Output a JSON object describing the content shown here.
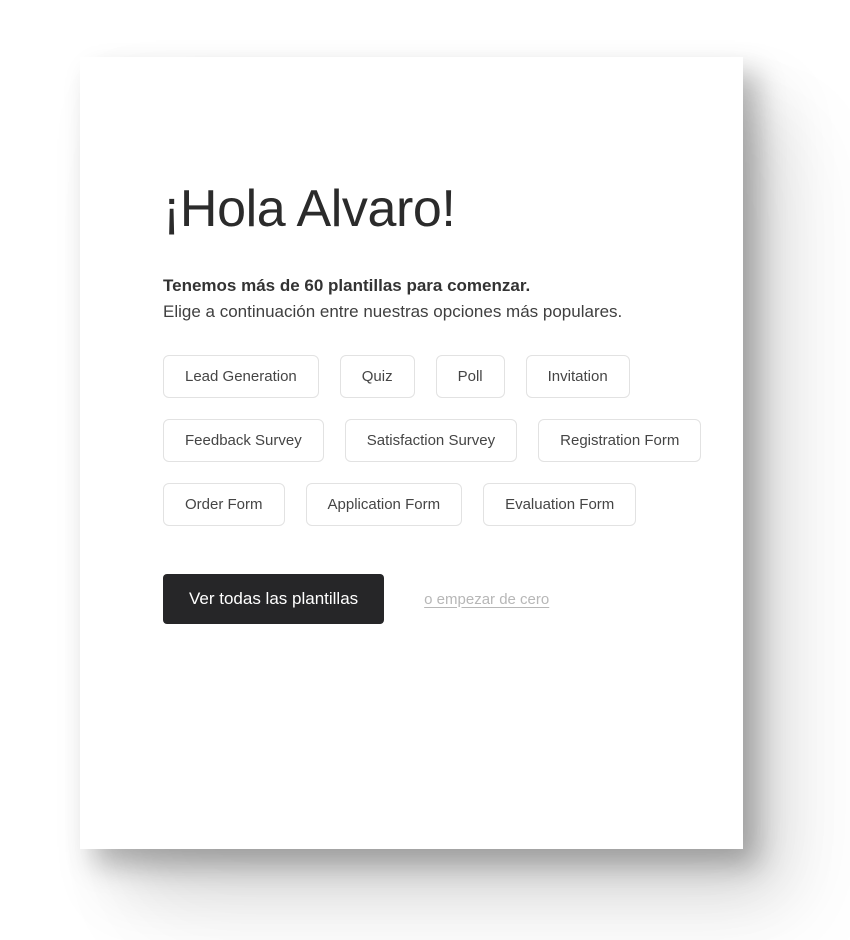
{
  "card": {
    "greeting": "¡Hola Alvaro!",
    "subtitle_line1": "Tenemos más de 60 plantillas para comenzar.",
    "subtitle_line2": "Elige a continuación entre nuestras opciones más populares.",
    "template_rows": [
      {
        "chips": [
          {
            "label": "Lead Generation"
          },
          {
            "label": "Quiz"
          },
          {
            "label": "Poll"
          },
          {
            "label": "Invitation"
          }
        ]
      },
      {
        "chips": [
          {
            "label": "Feedback Survey"
          },
          {
            "label": "Satisfaction Survey"
          },
          {
            "label": "Registration Form"
          }
        ]
      },
      {
        "chips": [
          {
            "label": "Order Form"
          },
          {
            "label": "Application Form"
          },
          {
            "label": "Evaluation Form"
          }
        ]
      }
    ],
    "primary_action": "Ver todas las plantillas",
    "secondary_action": "o empezar de cero"
  },
  "colors": {
    "page_background": "#ffffff",
    "card_background": "#ffffff",
    "heading_text": "#2b2b2b",
    "body_text": "#3a3a3a",
    "chip_border": "#e2e2e2",
    "chip_text": "#454545",
    "primary_button_bg": "#262628",
    "primary_button_text": "#ffffff",
    "secondary_link_text": "#b7b7b7"
  }
}
